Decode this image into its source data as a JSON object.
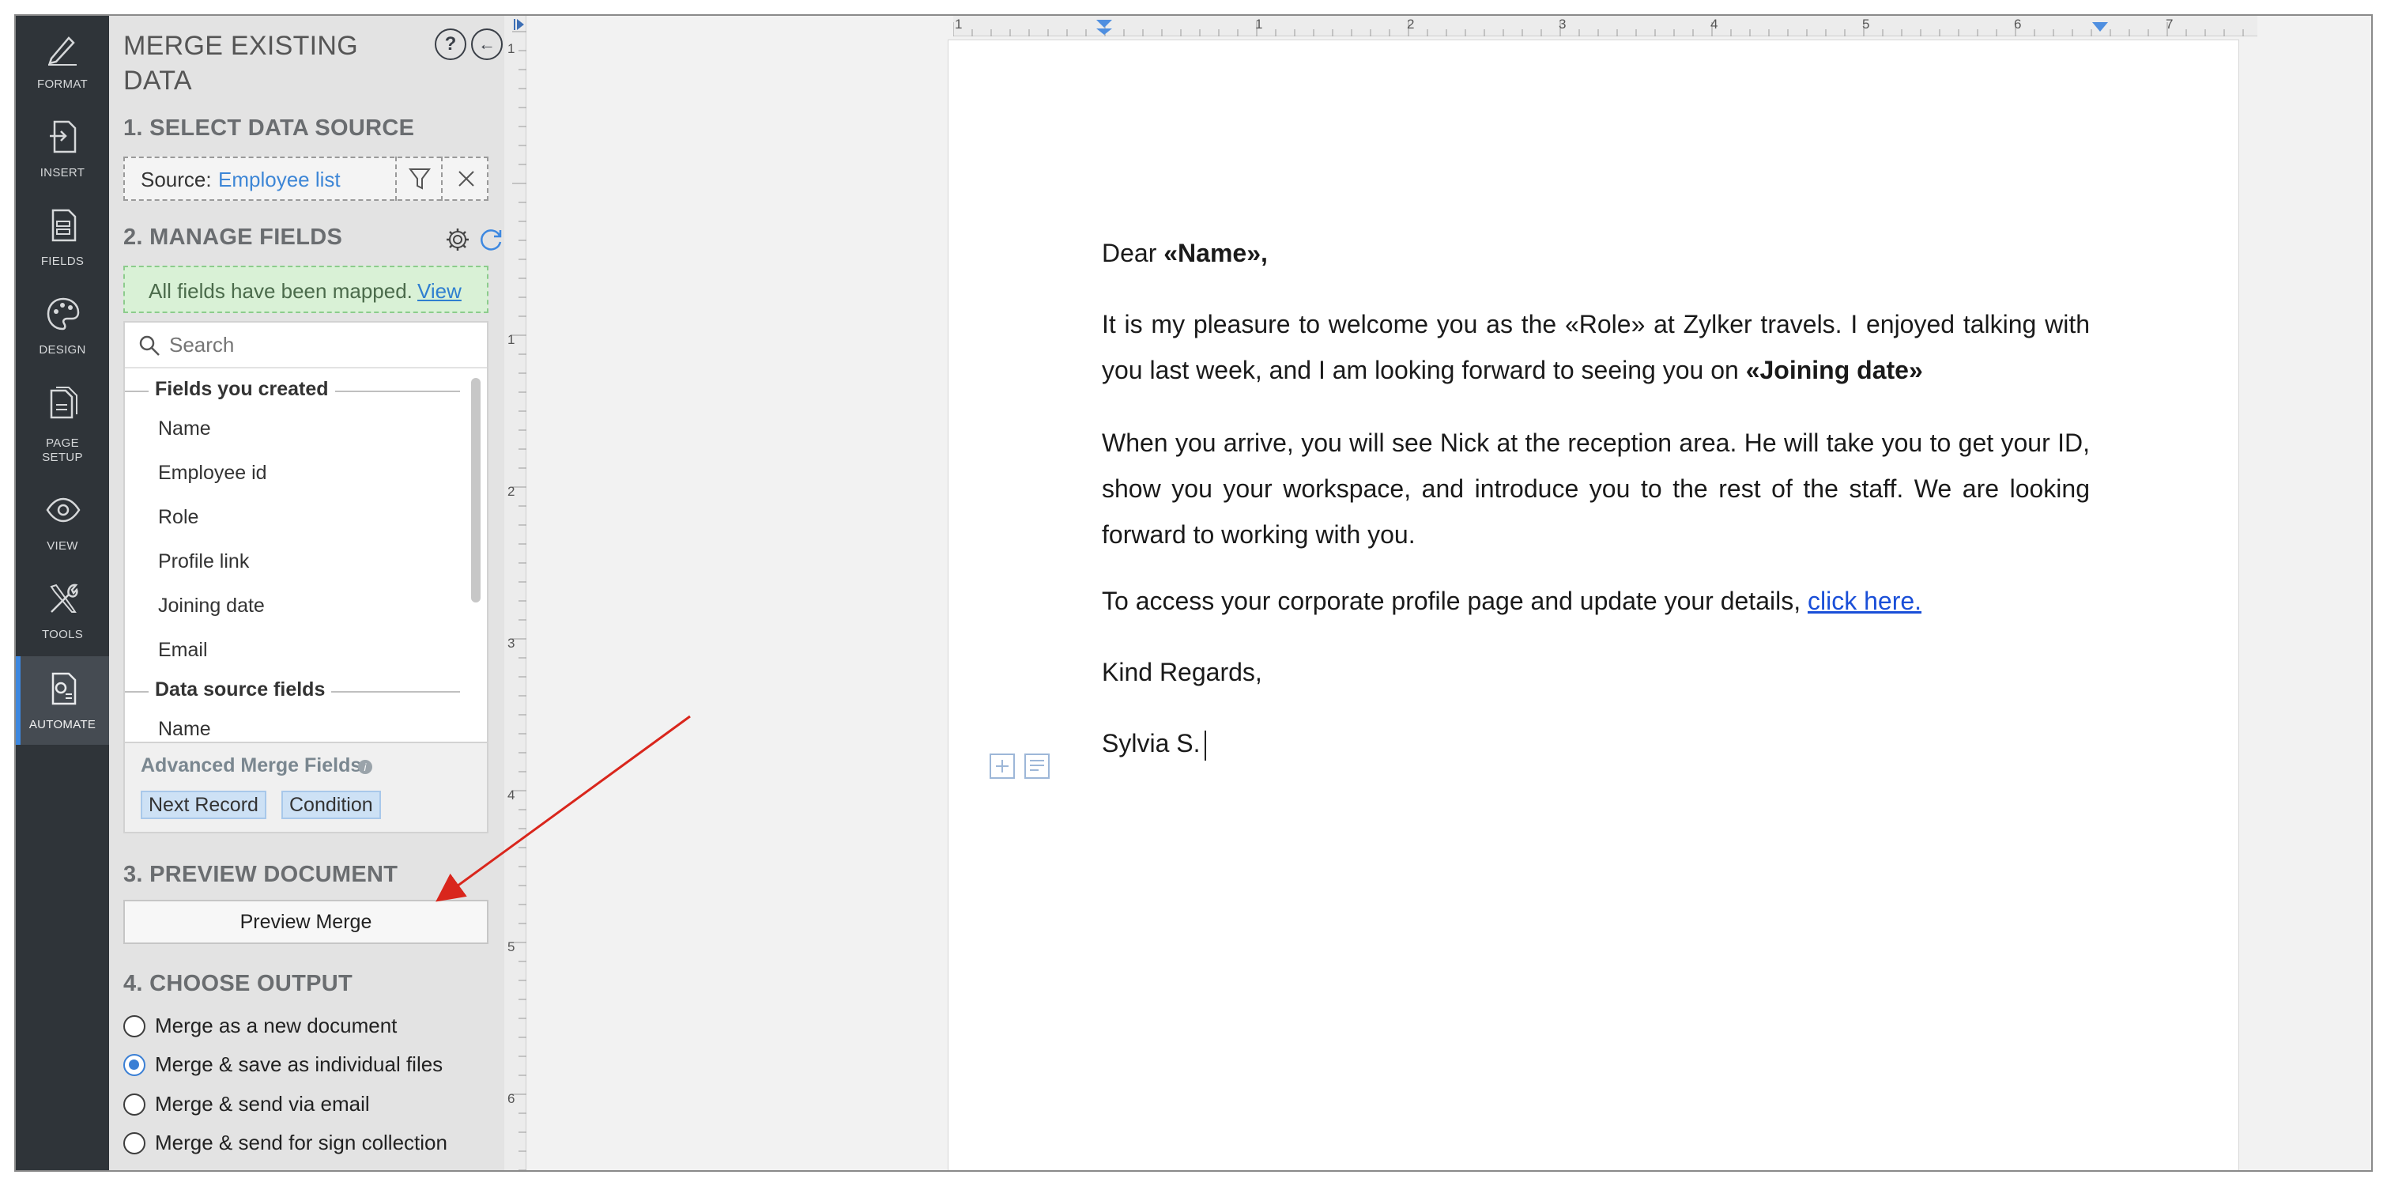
{
  "rail": {
    "items": [
      {
        "label": "FORMAT",
        "icon": "pen-icon"
      },
      {
        "label": "INSERT",
        "icon": "insert-icon"
      },
      {
        "label": "FIELDS",
        "icon": "fields-icon"
      },
      {
        "label": "DESIGN",
        "icon": "palette-icon"
      },
      {
        "label": "PAGE",
        "label2": "SETUP",
        "icon": "page-setup-icon"
      },
      {
        "label": "VIEW",
        "icon": "eye-icon"
      },
      {
        "label": "TOOLS",
        "icon": "tools-icon"
      },
      {
        "label": "AUTOMATE",
        "icon": "automate-icon"
      }
    ],
    "active": "AUTOMATE"
  },
  "panel": {
    "title": "MERGE EXISTING DATA",
    "help": "?",
    "back": "←",
    "section1": "1. SELECT DATA SOURCE",
    "source_label": "Source:",
    "source_value": "Employee list",
    "section2": "2. MANAGE FIELDS",
    "mapped_text": "All fields have been mapped.",
    "mapped_link": "View",
    "search_placeholder": "Search",
    "group1": "Fields you created",
    "fields_created": [
      "Name",
      "Employee id",
      "Role",
      "Profile link",
      "Joining date",
      "Email"
    ],
    "group2": "Data source fields",
    "fields_source": [
      "Name"
    ],
    "advanced_title": "Advanced Merge Fields",
    "chips": [
      "Next Record",
      "Condition"
    ],
    "section3": "3. PREVIEW DOCUMENT",
    "preview_button": "Preview Merge",
    "section4": "4. CHOOSE OUTPUT",
    "outputs": [
      {
        "label": "Merge as a new document",
        "selected": false
      },
      {
        "label": "Merge & save as individual files",
        "selected": true
      },
      {
        "label": "Merge & send via email",
        "selected": false
      },
      {
        "label": "Merge & send for sign collection",
        "selected": false
      }
    ]
  },
  "ruler": {
    "h_ticks": [
      "1",
      "1",
      "2",
      "3",
      "4",
      "5",
      "6",
      "7"
    ],
    "v_ticks": [
      "1",
      "1",
      "2",
      "3",
      "4",
      "5",
      "6"
    ]
  },
  "document": {
    "greeting_prefix": "Dear ",
    "greeting_field": "«Name»,",
    "p1": "It is my pleasure to welcome you as the «Role» at Zylker travels. I enjoyed talking with you last week, and I am looking forward to seeing you on ",
    "p1_field": "«Joining date»",
    "p2": "When you arrive, you will see Nick at the reception area. He will take you to get your ID, show you your workspace, and introduce you to the rest of the staff. We are looking forward to working with you.",
    "p3": "To access your corporate profile page and update your details, ",
    "p3_link": "click here.",
    "closing": "Kind Regards,",
    "signature": "Sylvia S."
  },
  "colors": {
    "rail_bg": "#2f3439",
    "accent": "#3d88e0",
    "annotation_arrow": "#d9261c",
    "mapped_bg": "#d9f1d6"
  }
}
